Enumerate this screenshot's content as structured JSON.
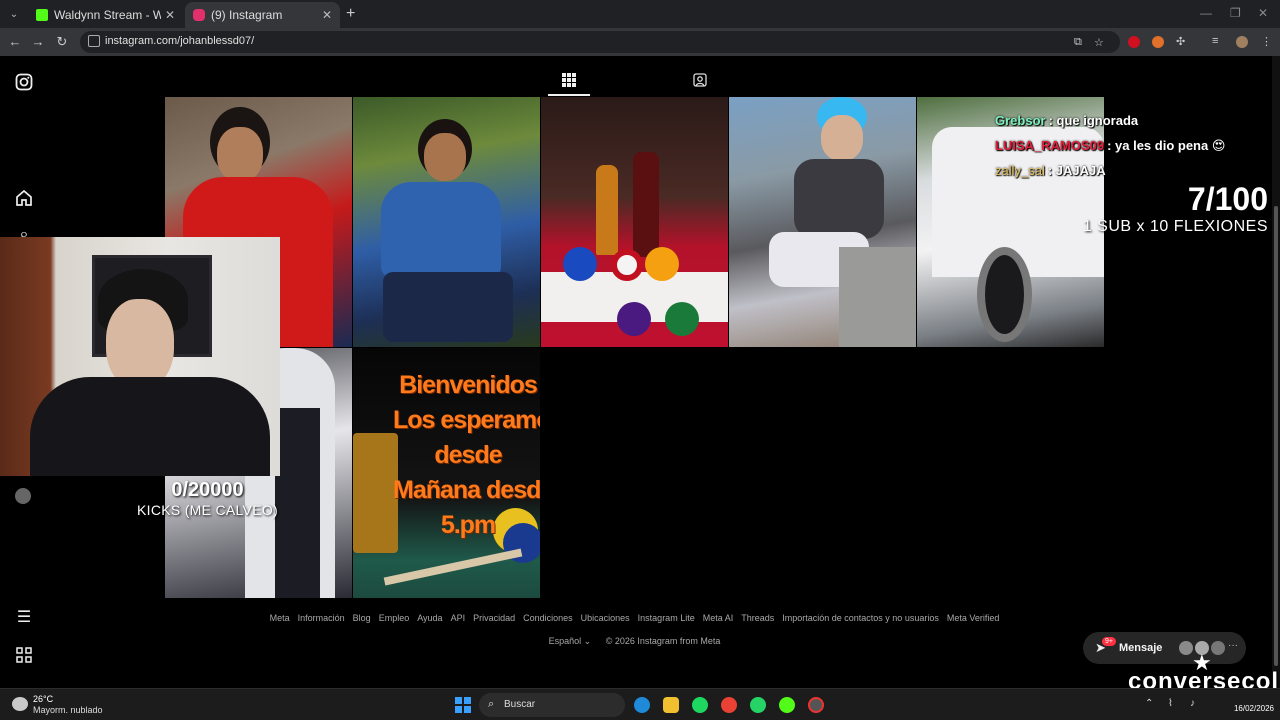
{
  "browser": {
    "tabs": [
      {
        "title": "Waldynn Stream - Watch Live o",
        "favicon_color": "#53fc18"
      },
      {
        "title": "(9) Instagram",
        "favicon_color": "#e1306c"
      }
    ],
    "url": "instagram.com/johanblessd07/",
    "icons": {
      "back": "arrow-left-icon",
      "forward": "arrow-right-icon",
      "reload": "reload-icon",
      "star": "bookmark-star-icon"
    }
  },
  "instagram": {
    "sidebar_icons": [
      "instagram-logo-icon",
      "home-icon",
      "search-icon",
      "menu-icon",
      "apps-icon"
    ],
    "profile_tabs": [
      "grid-icon",
      "tagged-icon"
    ],
    "posts": [
      {
        "alt": "post-1"
      },
      {
        "alt": "post-2"
      },
      {
        "alt": "post-3"
      },
      {
        "alt": "post-4"
      },
      {
        "alt": "post-5"
      },
      {
        "alt": "post-6"
      },
      {
        "alt": "post-7"
      }
    ],
    "post7_text": [
      "Bienvenidos",
      "Los esperamos",
      "desde",
      "Mañana desde l",
      "5.pm"
    ],
    "footer_links": [
      "Meta",
      "Información",
      "Blog",
      "Empleo",
      "Ayuda",
      "API",
      "Privacidad",
      "Condiciones",
      "Ubicaciones",
      "Instagram Lite",
      "Meta AI",
      "Threads",
      "Importación de contactos y no usuarios",
      "Meta Verified"
    ],
    "language": "Español ⌄",
    "copyright": "© 2026 Instagram from Meta",
    "messages": {
      "label": "Mensaje",
      "badge": "9+"
    }
  },
  "overlay": {
    "chat": [
      {
        "name": "Grebsor",
        "text": ": que ignorada",
        "color": "#7ef0c0"
      },
      {
        "name": "LUISA_RAMOS09",
        "text": ": ya les dio pena 😍",
        "color": "#e0203a"
      },
      {
        "name": "zally_sal",
        "text": ": JAJAJA",
        "color": "#e0c060"
      }
    ],
    "goal1": {
      "count": "7/100",
      "label": "1 SUB x 10 FLEXIONES"
    },
    "goal2": {
      "count": "0/20000",
      "label": "KICKS (ME CALVEO)"
    },
    "brand": "conversecol"
  },
  "taskbar": {
    "temperature": "26°C",
    "weather": "Mayorm. nublado",
    "search_placeholder": "Buscar",
    "date": "16/02/2026"
  }
}
